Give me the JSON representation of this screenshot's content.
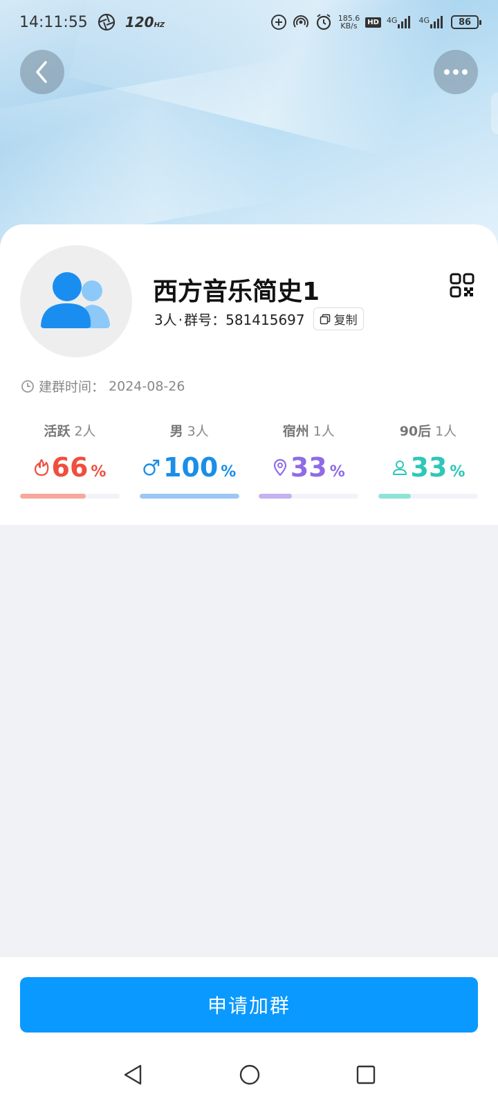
{
  "status_bar": {
    "time": "14:11:55",
    "refresh_rate": "120",
    "refresh_unit": "HZ",
    "net_speed_value": "185.6",
    "net_speed_unit": "KB/s",
    "hd_badge": "HD",
    "signal_1": "4G",
    "signal_2": "4G",
    "battery": "86"
  },
  "header": {
    "back_icon": "chevron-left-icon",
    "more_icon": "ellipsis-icon"
  },
  "group": {
    "name": "西方音乐简史1",
    "member_count": "3人",
    "separator": "·",
    "group_id_label": "群号：",
    "group_id": "581415697",
    "copy_label": "复制",
    "created_label": "建群时间：",
    "created_date": "2024-08-26"
  },
  "stats": [
    {
      "key": "活跃",
      "count": "2人",
      "value": "66",
      "unit": "%",
      "color": "#f04e3e",
      "track_color": "#f7a79b",
      "fill_pct": 66,
      "icon": "flame-icon"
    },
    {
      "key": "男",
      "count": "3人",
      "value": "100",
      "unit": "%",
      "color": "#1a8ee8",
      "track_color": "#9cc7f5",
      "fill_pct": 100,
      "icon": "male-icon"
    },
    {
      "key": "宿州",
      "count": "1人",
      "value": "33",
      "unit": "%",
      "color": "#8f6be6",
      "track_color": "#c6b1f2",
      "fill_pct": 33,
      "icon": "location-pin-icon"
    },
    {
      "key": "90后",
      "count": "1人",
      "value": "33",
      "unit": "%",
      "color": "#2ec7b8",
      "track_color": "#8fe3d8",
      "fill_pct": 33,
      "icon": "person-icon"
    }
  ],
  "footer": {
    "apply_label": "申请加群"
  },
  "colors": {
    "accent": "#0a99ff",
    "page_bg": "#f1f2f6"
  }
}
